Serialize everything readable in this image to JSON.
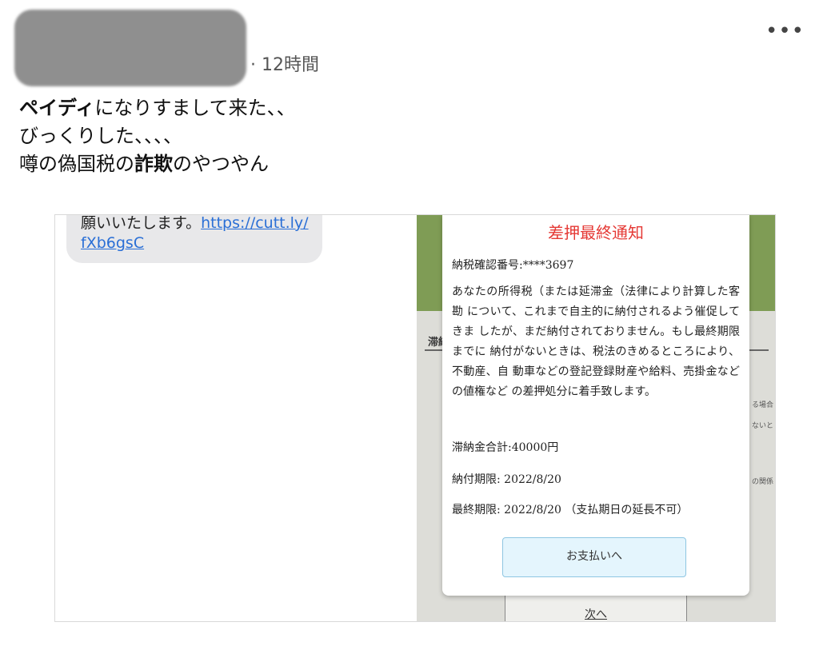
{
  "tweet": {
    "time": "· 12時間",
    "more_icon": "more-horizontal-icon",
    "text": {
      "line1_bold": "ペイディ",
      "line1_rest": "になりすまして来た、、",
      "line2": "びっくりした、、、、",
      "line3_pre": "噂の偽国税の",
      "line3_bold": "詐欺",
      "line3_post": "のやつやん"
    }
  },
  "sms": {
    "text": "願いいたします。",
    "link_part1": "https://cutt.ly/",
    "link_part2": "fXb6gsC"
  },
  "modal": {
    "title": "差押最終通知",
    "confirm_number": "納税確認番号:****3697",
    "body": "あなたの所得税（または延滞金（法律により計算した客勘 について、これまで自主的に納付されるよう催促してきま したが、まだ納付されておりません。もし最終期限までに 納付がないときは、税法のきめるところにより、不動産、自 動車などの登記登録財産や給料、売掛金などの値権など の差押処分に着手致します。",
    "total": "滞納金合計:40000円",
    "due_date": "納付期限: 2022/8/20",
    "final_date": "最終期限: 2022/8/20 （支払期日の延長不可）",
    "pay_button": "お支払いへ"
  },
  "background_page": {
    "section_label": "滞納",
    "side_note_1": "る場合",
    "side_note_2": "ないと",
    "side_note_3": "の関係",
    "next_link": "次へ"
  },
  "colors": {
    "modal_title": "#e53935",
    "link": "#2a6fd6",
    "pay_button_bg": "#e4f5fd"
  }
}
